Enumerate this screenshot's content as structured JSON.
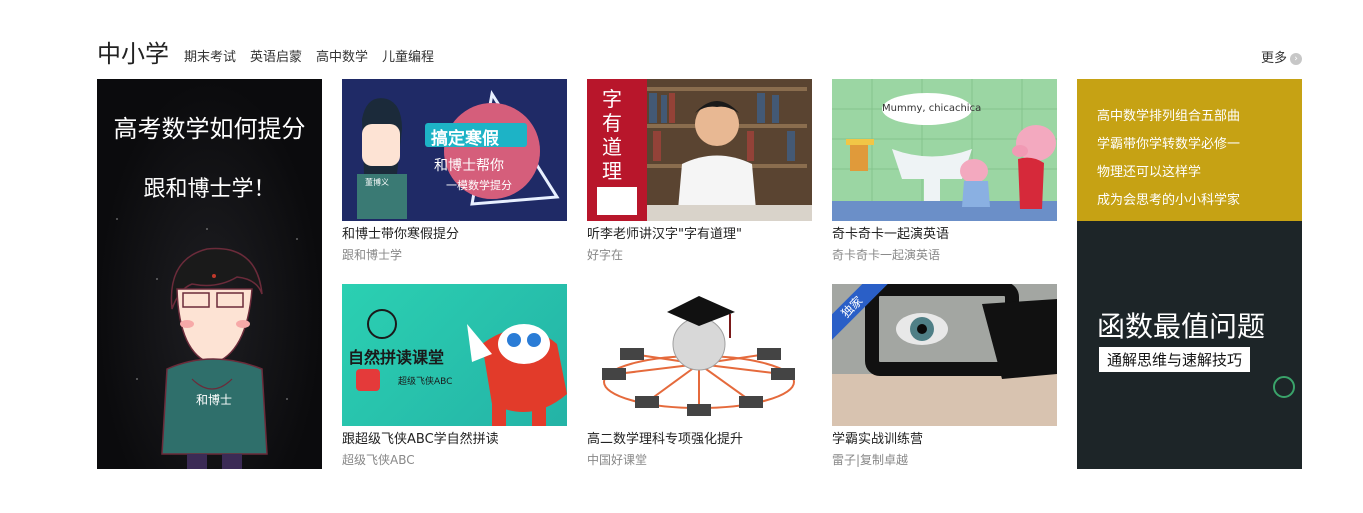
{
  "header": {
    "title": "中小学",
    "tabs": [
      "期末考试",
      "英语启蒙",
      "高中数学",
      "儿童编程"
    ],
    "more": "更多"
  },
  "left_banner": {
    "line1": "高考数学如何提分",
    "line2": "跟和博士学！",
    "character_label": "和博士"
  },
  "cards": [
    {
      "title": "和博士带你寒假提分",
      "sub": "跟和博士学",
      "thumb_text": [
        "搞定寒假",
        "和博士帮你",
        "一模数学提分"
      ],
      "badge": "董博义"
    },
    {
      "title": "听李老师讲汉字\"字有道理\"",
      "sub": "好字在",
      "thumb_text": [
        "字有道理"
      ]
    },
    {
      "title": "奇卡奇卡一起演英语",
      "sub": "奇卡奇卡一起演英语",
      "thumb_text": [
        "Mummy, chicachica"
      ]
    },
    {
      "title": "跟超级飞侠ABC学自然拼读",
      "sub": "超级飞侠ABC",
      "thumb_text": [
        "自然拼读课堂",
        "超级飞侠ABC"
      ]
    },
    {
      "title": "高二数学理科专项强化提升",
      "sub": "中国好课堂",
      "thumb_text": []
    },
    {
      "title": "学霸实战训练营",
      "sub": "雷子|复制卓越",
      "thumb_text": [],
      "badge": "独家"
    }
  ],
  "right_panel": {
    "links": [
      "高中数学排列组合五部曲",
      "学霸带你学转数学必修一",
      "物理还可以这样学",
      "成为会思考的小小科学家"
    ],
    "banner_big": "函数最值问题",
    "banner_sub": "通解思维与速解技巧"
  },
  "colors": {
    "accent_gold": "#c6a214",
    "dark_panel": "#1d2528",
    "ribbon_blue": "#2a5fc7"
  }
}
